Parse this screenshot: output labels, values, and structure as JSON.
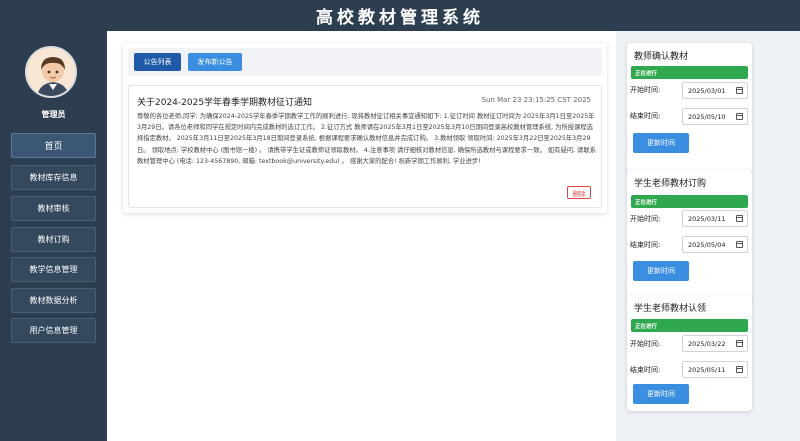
{
  "header": {
    "title": "高校教材管理系统"
  },
  "sidebar": {
    "role_label": "管理员",
    "items": [
      {
        "label": "首页",
        "active": true
      },
      {
        "label": "教材库存信息"
      },
      {
        "label": "教材审核"
      },
      {
        "label": "教材订购"
      },
      {
        "label": "教学信息管理"
      },
      {
        "label": "教材数据分析"
      },
      {
        "label": "用户信息管理"
      }
    ]
  },
  "main": {
    "tabs": {
      "list_label": "公告列表",
      "publish_label": "发布新公告"
    },
    "notice": {
      "title": "关于2024-2025学年春季学期教材征订通知",
      "date": "Sun Mar 23 23:15:25 CST 2025",
      "body": "尊敬的各位老师,同学: 为确保2024-2025学年春季学期教学工作的顺利进行, 现将教材征订相关事宜通知如下: 1.征订时间 教材征订时间为 2025年3月1日至2025年3月29日。请各位老师和同学在规定时间内完成教材的选订工作。 2.征订方式 教师请在2025年3月1日至2025年3月10日期间登录高校教材管理系统, 为所授课程选择指定教材。 2025年3月11日至2025年3月18日期间登录系统, 根据课程要求确认教材信息并完成订购。 3.教材领取 领取时间: 2025年3月22日至2025年3月29日。 领取地点: 学校教材中心 (图书馆一楼) 。 请携带学生证或教师证领取教材。 4.注意事项 请仔细核对教材信息, 确保所选教材与课程要求一致。 如有疑问, 请联系教材管理中心 (电话: 123-4567890, 邮箱: textbook@university.edu) 。 感谢大家的配合! 祝新学期工作顺利, 学业进步!",
      "delete_label": "删除"
    }
  },
  "right": {
    "panels": [
      {
        "title": "教师确认教材",
        "status": "正在进行",
        "start_label": "开始时间:",
        "start": "2025/03/01",
        "end_label": "结束时间:",
        "end": "2025/05/10",
        "button": "更新时间"
      },
      {
        "title": "学生老师教材订购",
        "status": "正在进行",
        "start_label": "开始时间:",
        "start": "2025/03/11",
        "end_label": "结束时间:",
        "end": "2025/05/04",
        "button": "更新时间"
      },
      {
        "title": "学生老师教材认领",
        "status": "正在进行",
        "start_label": "开始时间:",
        "start": "2025/03/22",
        "end_label": "结束时间:",
        "end": "2025/05/11",
        "button": "更新时间"
      }
    ]
  },
  "colors": {
    "sidebar": "#2c3e50",
    "primary": "#1e5aa8",
    "accent": "#3a8ee0",
    "status_green": "#2fa84f",
    "danger": "#e04848"
  }
}
